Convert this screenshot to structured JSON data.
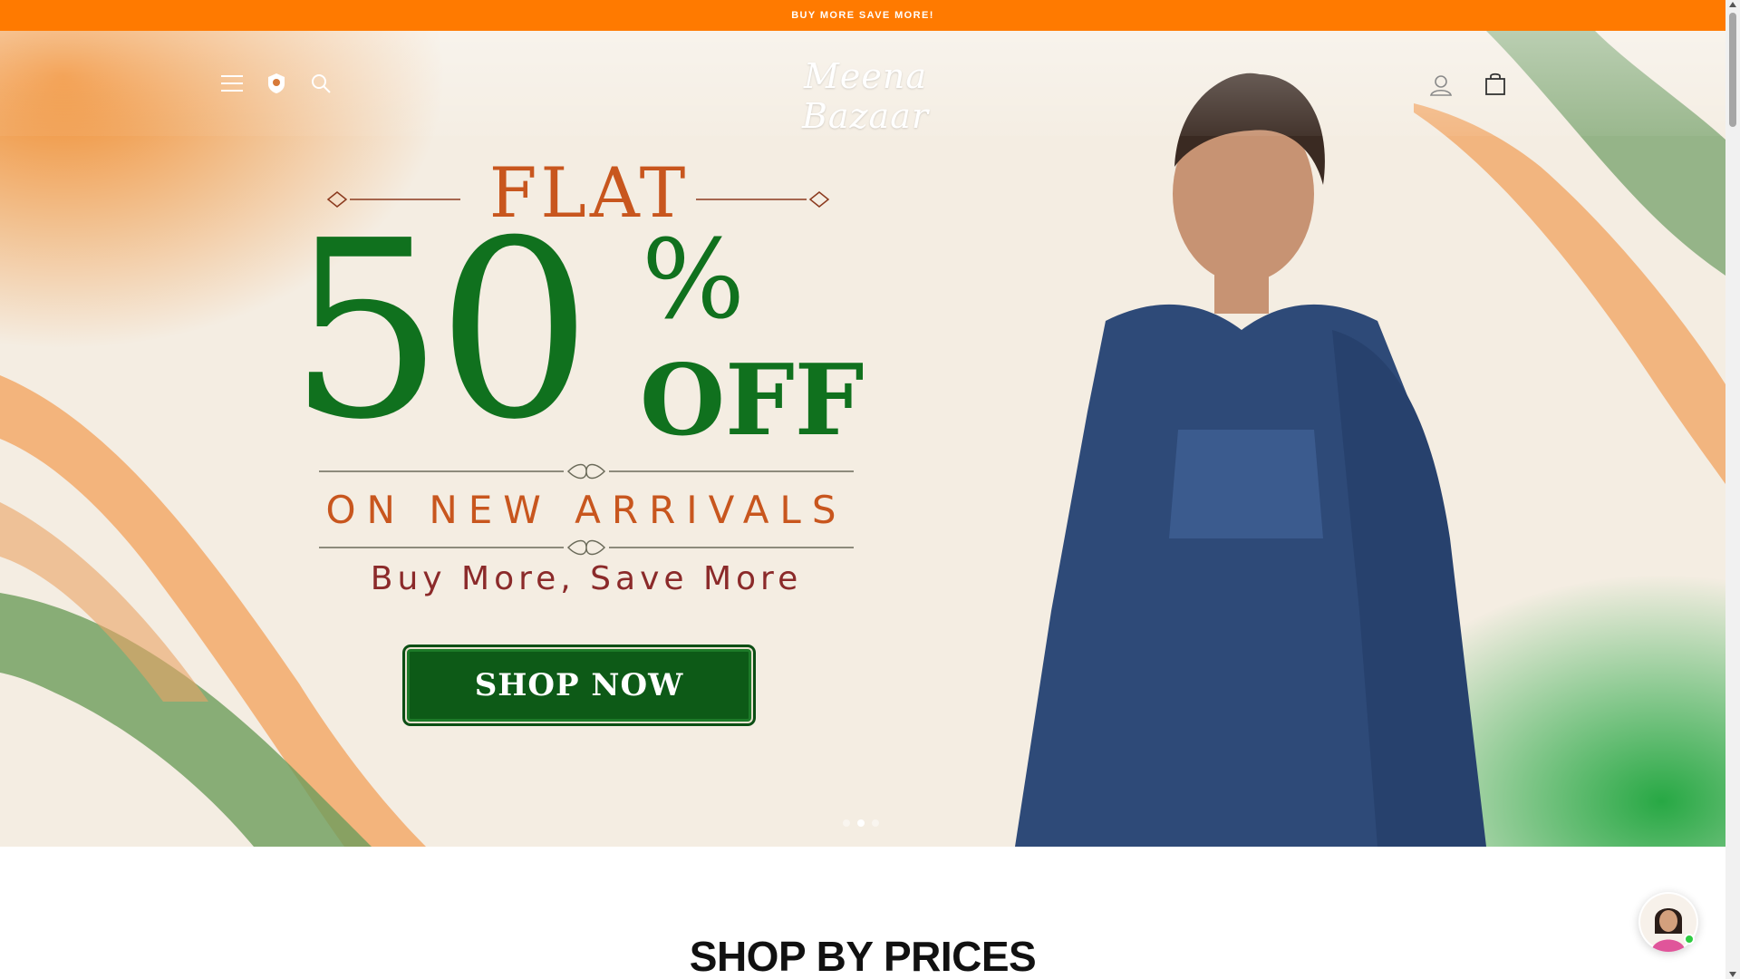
{
  "announcement": {
    "text": "BUY MORE SAVE MORE!"
  },
  "header": {
    "logo_text": "Meena Bazaar",
    "icons": [
      "menu-icon",
      "badge-icon",
      "search-icon",
      "account-icon",
      "cart-icon"
    ]
  },
  "hero": {
    "flat": "FLAT",
    "percent_value": "50",
    "percent_sign": "%",
    "off": "OFF",
    "arrivals": "ON NEW ARRIVALS",
    "tagline": "Buy More, Save More",
    "cta": "SHOP NOW",
    "slide_count": 3,
    "active_slide": 2
  },
  "section": {
    "title": "SHOP BY PRICES"
  },
  "colors": {
    "announcement_bg": "#ff7a00",
    "saffron": "#c8561e",
    "green": "#10711e",
    "cta_bg": "#0d5a17",
    "dress_blue": "#2e4a78"
  }
}
